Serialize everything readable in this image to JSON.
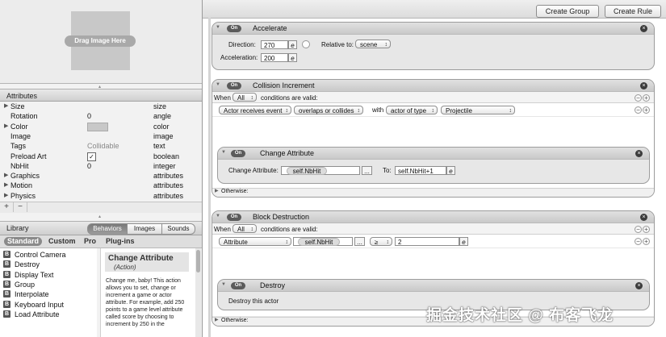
{
  "image_well": {
    "drop_label": "Drag Image Here"
  },
  "attributes": {
    "header": "Attributes",
    "rows": [
      {
        "name": "Size",
        "value": "",
        "type": "size",
        "expandable": true
      },
      {
        "name": "Rotation",
        "value": "0",
        "type": "angle",
        "expandable": false
      },
      {
        "name": "Color",
        "value": "",
        "type": "color",
        "expandable": true
      },
      {
        "name": "Image",
        "value": "",
        "type": "image",
        "expandable": false
      },
      {
        "name": "Tags",
        "value": "Collidable",
        "type": "text",
        "expandable": false
      },
      {
        "name": "Preload Art",
        "value": "",
        "type": "boolean",
        "expandable": false
      },
      {
        "name": "NbHit",
        "value": "0",
        "type": "integer",
        "expandable": false
      },
      {
        "name": "Graphics",
        "value": "",
        "type": "attributes",
        "expandable": true
      },
      {
        "name": "Motion",
        "value": "",
        "type": "attributes",
        "expandable": true
      },
      {
        "name": "Physics",
        "value": "",
        "type": "attributes",
        "expandable": true
      }
    ],
    "footer": {
      "add": "+",
      "remove": "−"
    }
  },
  "library": {
    "header": "Library",
    "tabs": [
      "Behaviors",
      "Images",
      "Sounds"
    ],
    "selected_tab": "Behaviors",
    "categories": [
      "Standard",
      "Custom",
      "Pro",
      "Plug-ins"
    ],
    "selected_category": "Standard",
    "items": [
      "Control Camera",
      "Destroy",
      "Display Text",
      "Group",
      "Interpolate",
      "Keyboard Input",
      "Load Attribute"
    ],
    "item_icon": "B",
    "description": {
      "title": "Change Attribute",
      "subtitle": "(Action)",
      "body": "Change me, baby! This action allows you to set, change or increment a game or actor attribute. For example, add 250 points to a game level attribute called score by choosing to increment by 250 in the"
    }
  },
  "toolbar": {
    "create_group": "Create Group",
    "create_rule": "Create Rule"
  },
  "blocks": {
    "accelerate": {
      "on": "On",
      "title": "Accelerate",
      "direction_label": "Direction:",
      "direction_value": "270",
      "relative_label": "Relative to:",
      "relative_value": "scene",
      "acceleration_label": "Acceleration:",
      "acceleration_value": "200",
      "edit_glyph": "e"
    },
    "collision": {
      "on": "On",
      "title": "Collision Increment",
      "when": "When",
      "all": "All",
      "cond_text": "conditions are valid:",
      "cond": {
        "p1": "Actor receives event",
        "p2": "overlaps or collides",
        "with": "with",
        "p3": "actor of type",
        "p4": "Projectile"
      },
      "inner": {
        "on": "On",
        "title": "Change Attribute",
        "label": "Change Attribute:",
        "attr_value": "self.NbHit",
        "dots": "...",
        "to_label": "To:",
        "to_value": "self.NbHit+1"
      },
      "otherwise": "Otherwise:"
    },
    "destruction": {
      "on": "On",
      "title": "Block Destruction",
      "when": "When",
      "all": "All",
      "cond_text": "conditions are valid:",
      "cond": {
        "p1": "Attribute",
        "attr": "self.NbHit",
        "dots": "...",
        "op": "≥",
        "value": "2"
      },
      "inner": {
        "on": "On",
        "title": "Destroy",
        "text": "Destroy this actor"
      },
      "otherwise": "Otherwise:"
    }
  },
  "watermark": "掘金技术社区 @ 布客飞龙"
}
